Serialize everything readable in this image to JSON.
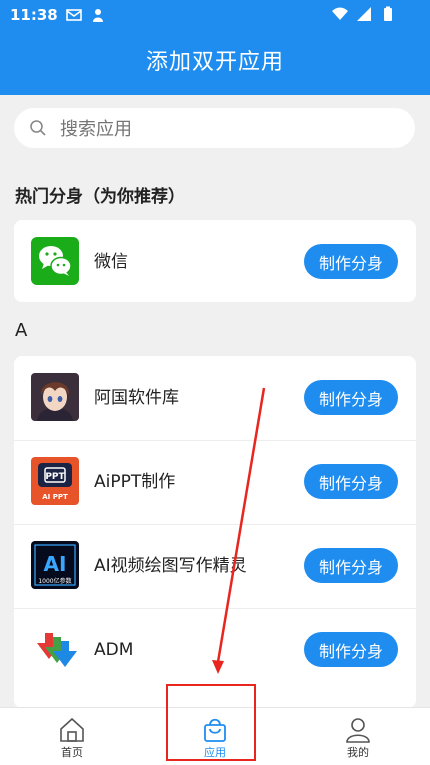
{
  "status": {
    "time": "11:38"
  },
  "header": {
    "title": "添加双开应用"
  },
  "search": {
    "placeholder": "搜索应用"
  },
  "hot": {
    "title": "热门分身（为你推荐）",
    "apps": [
      {
        "name": "微信",
        "button": "制作分身"
      }
    ]
  },
  "groups": [
    {
      "letter": "A",
      "apps": [
        {
          "name": "阿国软件库",
          "button": "制作分身"
        },
        {
          "name": "AiPPT制作",
          "button": "制作分身"
        },
        {
          "name": "AI视频绘图写作精灵",
          "button": "制作分身"
        },
        {
          "name": "ADM",
          "button": "制作分身"
        }
      ]
    }
  ],
  "icons": {
    "aippt_badge": "PPT",
    "aippt_caption": "AI PPT",
    "ai_badge": "AI",
    "ai_caption": "1000亿参数"
  },
  "nav": [
    {
      "label": "首页",
      "icon": "home-icon"
    },
    {
      "label": "应用",
      "icon": "bag-icon"
    },
    {
      "label": "我的",
      "icon": "user-icon"
    }
  ],
  "colors": {
    "primary": "#1f8df0",
    "annotation": "#e8261f"
  }
}
